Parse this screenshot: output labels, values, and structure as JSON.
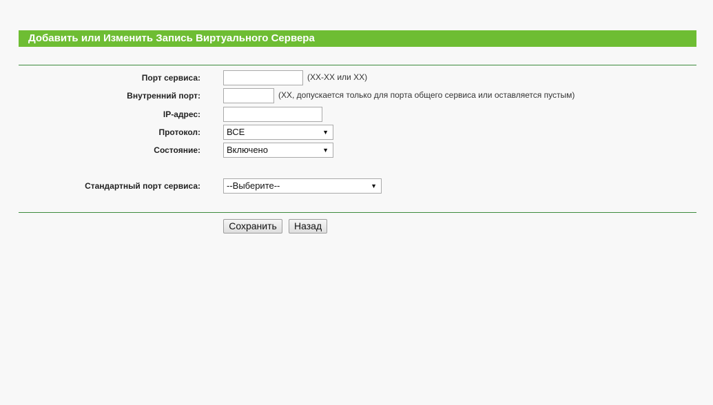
{
  "header": {
    "title": "Добавить или Изменить Запись Виртуального Сервера"
  },
  "form": {
    "service_port": {
      "label": "Порт сервиса:",
      "value": "",
      "hint": "(XX-XX или XX)"
    },
    "internal_port": {
      "label": "Внутренний порт:",
      "value": "",
      "hint": "(XX, допускается только для порта общего сервиса или оставляется пустым)"
    },
    "ip_address": {
      "label": "IP-адрес:",
      "value": ""
    },
    "protocol": {
      "label": "Протокол:",
      "selected": "ВСЕ"
    },
    "status": {
      "label": "Состояние:",
      "selected": "Включено"
    },
    "common_service_port": {
      "label": "Стандартный порт сервиса:",
      "selected": "--Выберите--"
    }
  },
  "buttons": {
    "save": "Сохранить",
    "back": "Назад"
  },
  "colors": {
    "title_bar": "#6ebd33",
    "divider": "#3c8a3c",
    "background": "#f8f8f8"
  }
}
